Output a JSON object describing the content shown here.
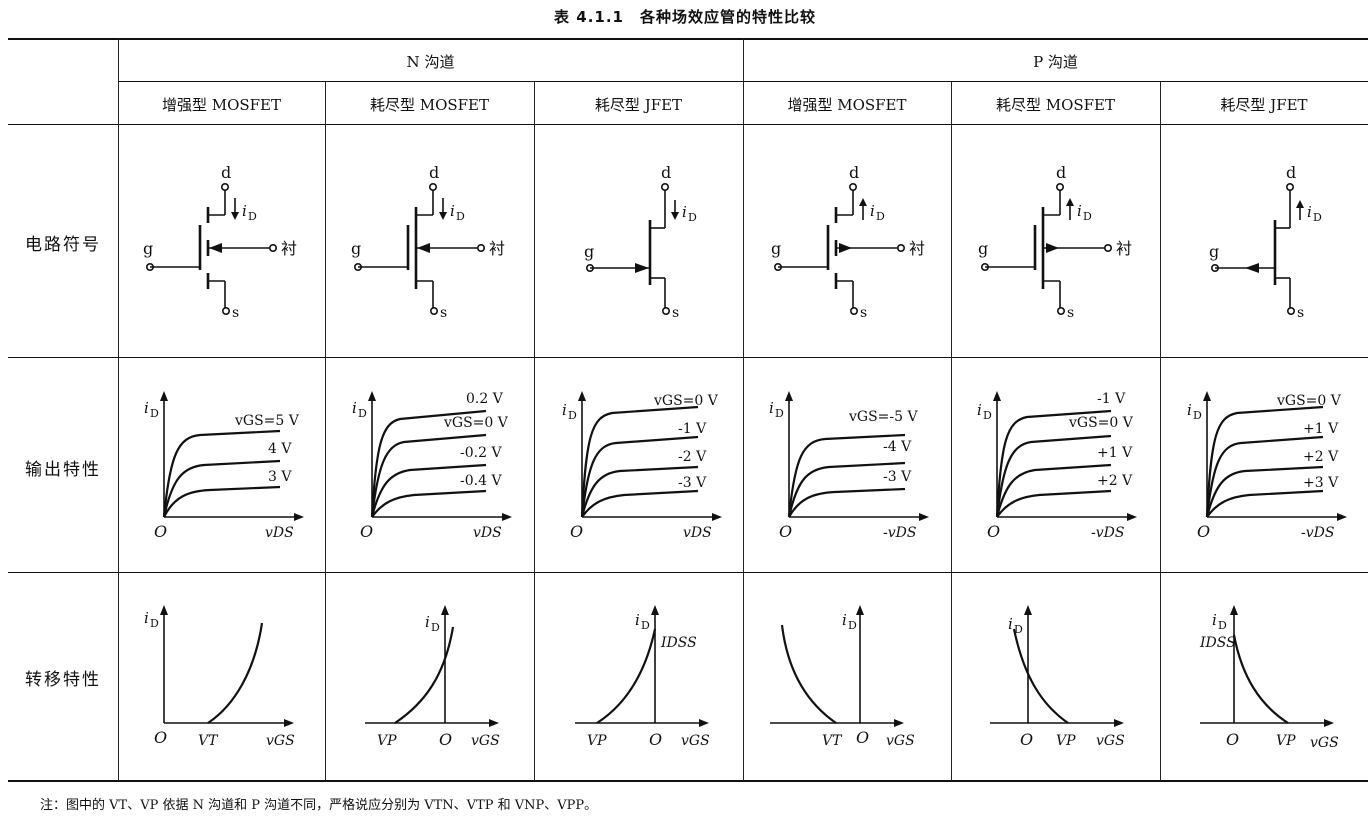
{
  "title": "表 4.1.1　各种场效应管的特性比较",
  "groups": [
    {
      "label": "N 沟道"
    },
    {
      "label": "P 沟道"
    }
  ],
  "columns": [
    {
      "label": "增强型 MOSFET"
    },
    {
      "label": "耗尽型 MOSFET"
    },
    {
      "label": "耗尽型 JFET"
    },
    {
      "label": "增强型 MOSFET"
    },
    {
      "label": "耗尽型 MOSFET"
    },
    {
      "label": "耗尽型 JFET"
    }
  ],
  "rows": [
    {
      "label": "电路符号"
    },
    {
      "label": "输出特性"
    },
    {
      "label": "转移特性"
    }
  ],
  "symbol_labels": {
    "drain": "d",
    "source": "s",
    "gate": "g",
    "substrate": "衬",
    "current": "i",
    "current_sub": "D"
  },
  "output_curves": [
    {
      "labels": [
        "vGS=5 V",
        "4 V",
        "3 V"
      ],
      "x_label": "vDS"
    },
    {
      "labels": [
        "0.2 V",
        "vGS=0 V",
        "-0.2 V",
        "-0.4 V"
      ],
      "x_label": "vDS"
    },
    {
      "labels": [
        "vGS=0 V",
        "-1 V",
        "-2 V",
        "-3 V"
      ],
      "x_label": "vDS"
    },
    {
      "labels": [
        "vGS=-5 V",
        "-4 V",
        "-3 V"
      ],
      "x_label": "-vDS"
    },
    {
      "labels": [
        "-1 V",
        "vGS=0 V",
        "+1 V",
        "+2 V"
      ],
      "x_label": "-vDS"
    },
    {
      "labels": [
        "vGS=0 V",
        "+1 V",
        "+2 V",
        "+3 V"
      ],
      "x_label": "-vDS"
    }
  ],
  "transfer_curves": [
    {
      "marker": "VT",
      "x_label": "vGS"
    },
    {
      "marker": "VP",
      "x_label": "vGS"
    },
    {
      "marker": "VP",
      "x_label": "vGS",
      "peak": "IDSS"
    },
    {
      "marker": "VT",
      "x_label": "vGS"
    },
    {
      "marker": "VP",
      "x_label": "vGS"
    },
    {
      "marker": "VP",
      "x_label": "vGS",
      "peak": "IDSS"
    }
  ],
  "origin_label": "O",
  "note": "注：图中的 VT、VP 依据 N 沟道和 P 沟道不同，严格说应分别为 VTN、VTP 和 VNP、VPP。"
}
